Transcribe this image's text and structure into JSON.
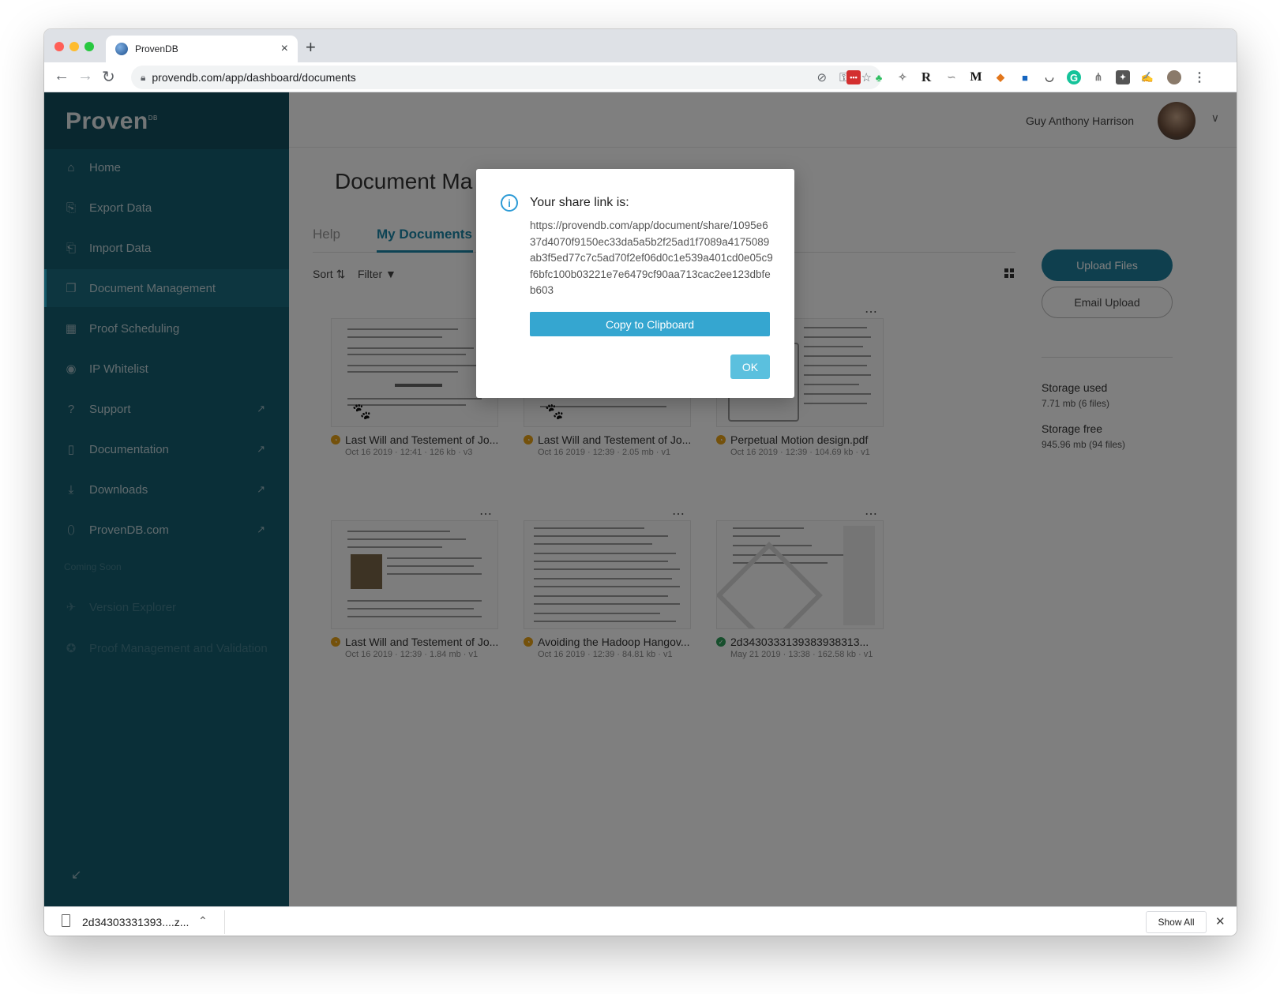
{
  "browser": {
    "tab_title": "ProvenDB",
    "url": "provendb.com/app/dashboard/documents",
    "new_tab": "+",
    "tab_close": "×"
  },
  "sidebar": {
    "logo": "Proven",
    "logo_sup": "DB",
    "items": [
      {
        "label": "Home",
        "icon": "home-icon"
      },
      {
        "label": "Export Data",
        "icon": "export-icon"
      },
      {
        "label": "Import Data",
        "icon": "import-icon"
      },
      {
        "label": "Document Management",
        "icon": "documents-icon",
        "active": true
      },
      {
        "label": "Proof Scheduling",
        "icon": "calendar-icon"
      },
      {
        "label": "IP Whitelist",
        "icon": "location-icon"
      },
      {
        "label": "Support",
        "icon": "help-icon"
      },
      {
        "label": "Documentation",
        "icon": "file-icon"
      },
      {
        "label": "Downloads",
        "icon": "download-icon"
      },
      {
        "label": "ProvenDB.com",
        "icon": "link-icon"
      }
    ],
    "coming_soon": "Coming Soon",
    "disabled_items": [
      "Version Explorer",
      "Proof Management and Validation"
    ]
  },
  "header": {
    "user_name": "Guy Anthony Harrison"
  },
  "main": {
    "title": "Document Ma",
    "tabs": [
      "Help",
      "My Documents"
    ],
    "sort": "Sort",
    "filter": "Filter",
    "upload_button": "Upload Files",
    "email_button": "Email Upload",
    "storage_used_label": "Storage used",
    "storage_used_value": "7.71 mb (6 files)",
    "storage_free_label": "Storage free",
    "storage_free_value": "945.96 mb (94 files)"
  },
  "documents": [
    {
      "title": "Last Will and Testement of Jo...",
      "meta": "Oct 16 2019 · 12:41 · 126 kb · v3",
      "status": "pending"
    },
    {
      "title": "Last Will and Testement of Jo...",
      "meta": "Oct 16 2019 · 12:39 · 2.05 mb · v1",
      "status": "pending"
    },
    {
      "title": "Perpetual Motion design.pdf",
      "meta": "Oct 16 2019 · 12:39 · 104.69 kb · v1",
      "status": "pending"
    },
    {
      "title": "Last Will and Testement of Jo...",
      "meta": "Oct 16 2019 · 12:39 · 1.84 mb · v1",
      "status": "pending"
    },
    {
      "title": "Avoiding the Hadoop Hangov...",
      "meta": "Oct 16 2019 · 12:39 · 84.81 kb · v1",
      "status": "pending"
    },
    {
      "title": "2d3430333139383938313...",
      "meta": "May 21 2019 · 13:38 · 162.58 kb · v1",
      "status": "verified"
    }
  ],
  "modal": {
    "title": "Your share link is:",
    "link": "https://provendb.com/app/document/share/1095e637d4070f9150ec33da5a5b2f25ad1f7089a4175089ab3f5ed77c7c5ad70f2ef06d0c1e539a401cd0e05c9f6bfc100b03221e7e6479cf90aa713cac2ee123dbfeb603",
    "copy_button": "Copy to Clipboard",
    "ok_button": "OK"
  },
  "download_bar": {
    "file_name": "2d34303331393....z...",
    "show_all": "Show All"
  },
  "colors": {
    "sidebar": "#155f70",
    "accent": "#1f7f9c",
    "copy_button": "#35a6d0",
    "ok_button": "#5bc0de",
    "pending": "#e8a317",
    "verified": "#2e9e5b"
  }
}
